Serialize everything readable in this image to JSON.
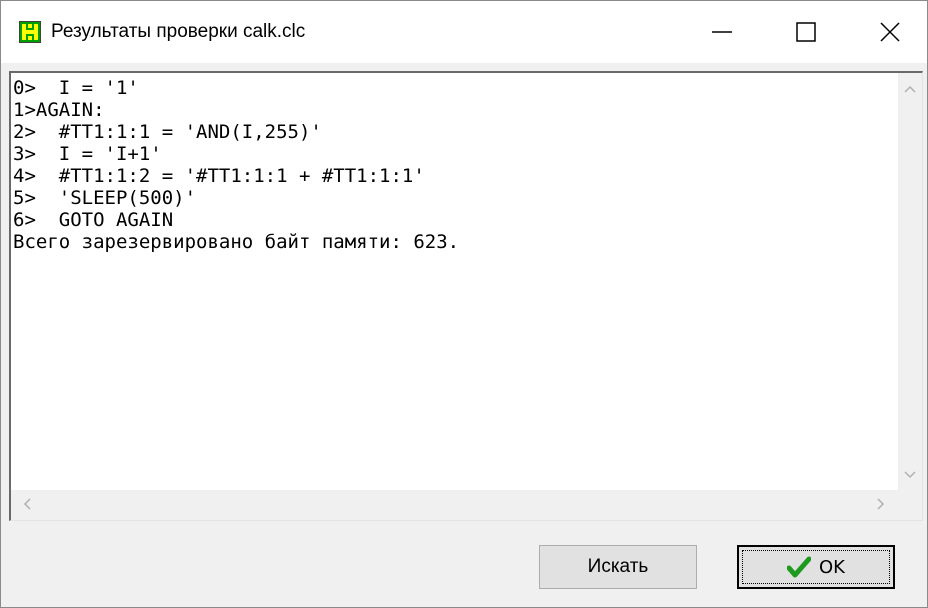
{
  "window": {
    "title": "Результаты проверки calk.clc"
  },
  "titlebar_icons": {
    "app": "app-icon",
    "minimize": "minimize-icon",
    "maximize": "maximize-icon",
    "close": "close-icon"
  },
  "output": {
    "lines": [
      "0>  I = '1'",
      "1>AGAIN:",
      "2>  #TT1:1:1 = 'AND(I,255)'",
      "3>  I = 'I+1'",
      "4>  #TT1:1:2 = '#TT1:1:1 + #TT1:1:1'",
      "5>  'SLEEP(500)'",
      "6>  GOTO AGAIN",
      "Всего зарезервировано байт памяти: 623."
    ]
  },
  "buttons": {
    "search_label": "Искать",
    "ok_label": "OK",
    "ok_icon": "checkmark-icon"
  },
  "colors": {
    "app_icon_bg": "#00a000",
    "checkmark": "#1e9a1e"
  }
}
